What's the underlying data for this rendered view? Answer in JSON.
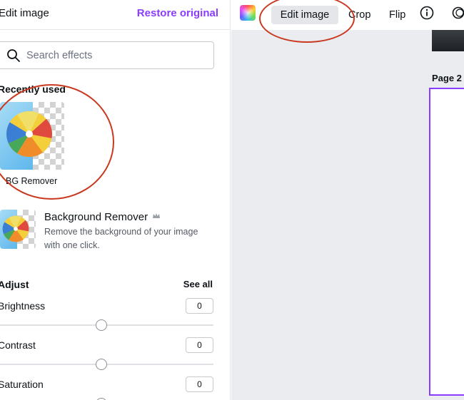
{
  "panel": {
    "title": "Edit image",
    "restore_label": "Restore original",
    "search_placeholder": "Search effects"
  },
  "recently_used": {
    "title": "Recently used",
    "items": [
      {
        "label": "BG Remover"
      }
    ]
  },
  "effects": [
    {
      "name": "Background Remover",
      "badge": "crown-icon",
      "description": "Remove the background of your image with one click."
    }
  ],
  "adjust": {
    "title": "Adjust",
    "see_all": "See all",
    "controls": [
      {
        "label": "Brightness",
        "value": "0"
      },
      {
        "label": "Contrast",
        "value": "0"
      },
      {
        "label": "Saturation",
        "value": "0"
      }
    ]
  },
  "toolbar": {
    "color_icon": "rainbow-color-icon",
    "edit_image": "Edit image",
    "crop": "Crop",
    "flip": "Flip",
    "info_icon": "info-icon",
    "extra_icon": "animate-icon"
  },
  "canvas": {
    "page_label": "Page 2"
  },
  "colors": {
    "accent": "#8b3dff",
    "annotation": "#c8391f",
    "canvas_bg": "#ebecf0"
  }
}
